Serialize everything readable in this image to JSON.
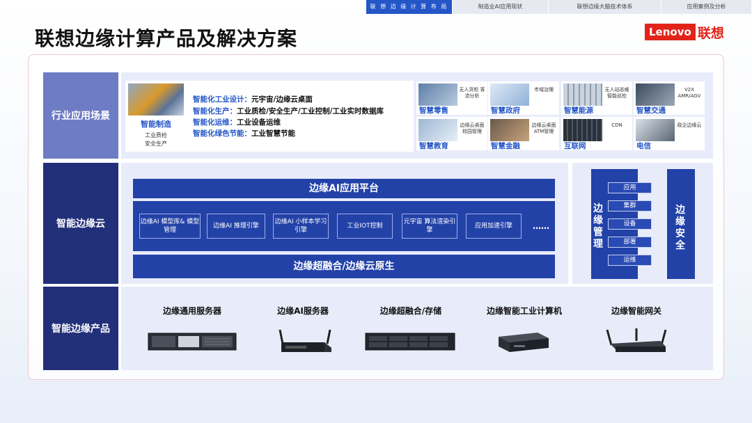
{
  "nav": {
    "tabs": [
      "联 想 边 缘 计 算 布 局",
      "制造业AI应用现状",
      "联想边缘大脑技术体系",
      "应用案例及分析"
    ]
  },
  "title": "联想边缘计算产品及解决方案",
  "logo": {
    "brand": "Lenovo",
    "cn": "联想"
  },
  "rows": {
    "industry": "行业应用场景",
    "cloud": "智能边缘云",
    "products": "智能边缘产品"
  },
  "manufacturing": {
    "name": "智能制造",
    "sub": [
      "工业质检",
      "安全生产"
    ],
    "lines": [
      {
        "k": "智能化工业设计：",
        "v": "元宇宙/边缘云桌面"
      },
      {
        "k": "智能化生产：",
        "v": "工业质检/安全生产/工业控制/工业实时数据库"
      },
      {
        "k": "智能化运维：",
        "v": "工业设备运维"
      },
      {
        "k": "智能化绿色节能：",
        "v": "工业智慧节能"
      }
    ]
  },
  "tiles": [
    {
      "name": "智慧零售",
      "desc": "无人货柜 客流分析"
    },
    {
      "name": "智慧政府",
      "desc": "市域治理"
    },
    {
      "name": "智慧能源",
      "desc": "无人站巡维 智能巡检"
    },
    {
      "name": "智慧交通",
      "desc": "V2X AMR/AGV"
    },
    {
      "name": "智慧教育",
      "desc": "边缘云桌面 校园管理"
    },
    {
      "name": "智慧金融",
      "desc": "边缘云桌面 ATM管理"
    },
    {
      "name": "互联网",
      "desc": "CDN"
    },
    {
      "name": "电信",
      "desc": "政企边缘云"
    }
  ],
  "cloud": {
    "platform": "边缘AI应用平台",
    "engines": [
      "边缘AI 模型库& 模型管理",
      "边缘AI 推理引擎",
      "边缘AI 小样本学习引擎",
      "工业IOT控制",
      "元宇宙 算法渲染引擎",
      "应用加速引擎"
    ],
    "more": "……",
    "base": "边缘超融合/边缘云原生",
    "management": {
      "title": "边缘管理",
      "items": [
        "应用",
        "集群",
        "设备",
        "部署",
        "运维"
      ]
    },
    "security": "边缘安全"
  },
  "products": [
    "边缘通用服务器",
    "边缘AI服务器",
    "边缘超融合/存储",
    "边缘智能工业计算机",
    "边缘智能网关"
  ],
  "colors": {
    "accent": "#2456c8",
    "dark": "#22307a",
    "brand": "#e2231a"
  }
}
